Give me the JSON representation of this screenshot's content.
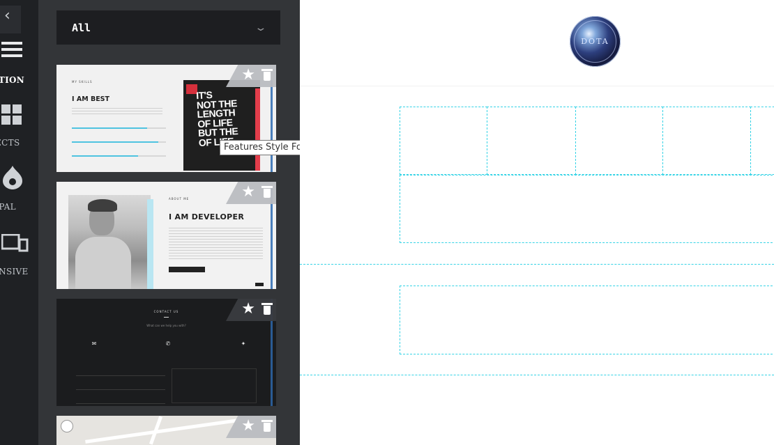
{
  "rail": {
    "back_icon": "chevron-left-icon",
    "items": [
      {
        "label": "CTION",
        "icon": "menu-icon",
        "active": true
      },
      {
        "label": "JECTS",
        "icon": "grid-icon",
        "active": false
      },
      {
        "label": "UPAL",
        "icon": "drupal-icon",
        "active": false
      },
      {
        "label": "ONSIVE",
        "icon": "responsive-icon",
        "active": false
      }
    ]
  },
  "panel": {
    "filter": {
      "value": "All"
    },
    "tooltip": "Features Style Four",
    "cards": [
      {
        "name": "Features Style Four",
        "subtitle": "MY SKILLS",
        "title": "I AM BEST",
        "poster_text": [
          "IT'S",
          "NOT THE",
          "LENGTH",
          "OF LIFE",
          "BUT THE",
          "OF LIFE"
        ]
      },
      {
        "subtitle": "ABOUT ME",
        "title": "I AM DEVELOPER"
      },
      {
        "subtitle": "CONTACT US",
        "question": "What can we help you with?"
      },
      {
        "type": "map"
      }
    ]
  },
  "canvas": {
    "logo_text": "DOTA"
  },
  "colors": {
    "rail_bg": "#1f2124",
    "panel_bg": "#333538",
    "filter_bg": "#1d1e21",
    "guide": "#34d3e6"
  }
}
